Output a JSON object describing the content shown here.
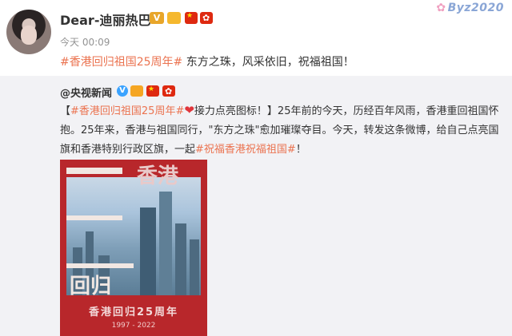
{
  "post": {
    "user_name": "Dear-迪丽热巴",
    "vip_label": "V",
    "time": "今天 00:09",
    "hashtag": "#香港回归祖国25周年#",
    "text": " 东方之珠，风采依旧，祝福祖国！",
    "watermark": "Byz2020"
  },
  "repost": {
    "author": "@央视新闻",
    "verified_label": "V",
    "text_bracket_open": "【",
    "hashtag1": "#香港回归祖国25周年#",
    "text1": "接力点亮图标！】25年前的今天，历经百年风雨，香港重回祖国怀抱。25年来，香港与祖国同行，\"东方之珠\"愈加璀璨夺目。今天，转发这条微博，给自己点亮国旗和香港特别行政区旗，一起",
    "hashtag2": "#祝福香港祝福祖国#",
    "text2": "！",
    "poster": {
      "big_chars_top": "香港",
      "big_chars_mid": "回归",
      "title": "香港回归25周年",
      "years": "1997 - 2022"
    }
  },
  "colors": {
    "hashtag": "#eb7350",
    "repost_bg": "#f2f2f5",
    "poster_red": "#b8272b"
  }
}
